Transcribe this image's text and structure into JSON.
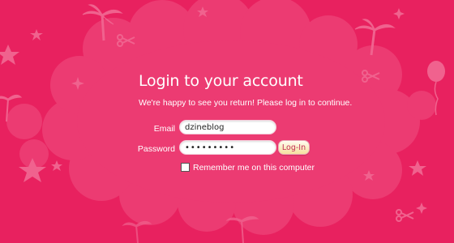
{
  "colors": {
    "background": "#e8215f",
    "cloud": "#ec3b72",
    "decoration": "#f0628e",
    "text": "#ffffff",
    "button_text": "#c23058"
  },
  "login": {
    "heading": "Login to your account",
    "subheading": "We're happy to see you return! Please log in to continue.",
    "email_label": "Email",
    "email_value": "dzineblog",
    "password_label": "Password",
    "password_value": "123456789",
    "button_label": "Log-In",
    "remember_label": "Remember me on this computer",
    "remember_checked": false
  },
  "decorations": [
    "palm-tree-icon",
    "star-icon",
    "scissors-icon",
    "balloon-icon",
    "sparkle-icon"
  ]
}
